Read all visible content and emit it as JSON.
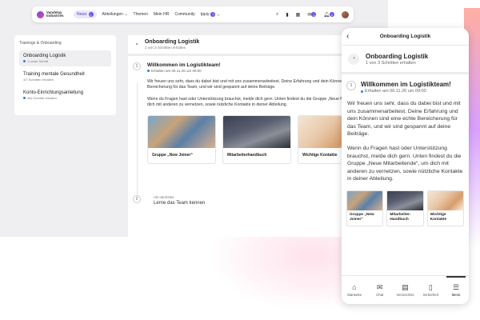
{
  "topbar": {
    "logo_text": "Vandelay Industries",
    "nav": [
      {
        "label": "News",
        "badge": "2"
      },
      {
        "label": "Abteilungen"
      },
      {
        "label": "Themen"
      },
      {
        "label": "Mein HR"
      },
      {
        "label": "Community"
      },
      {
        "label": "Mehr",
        "badge": "1"
      }
    ],
    "notification_badges": {
      "chat": "1",
      "bell": "2"
    }
  },
  "sidebar": {
    "title": "Trainings & Onboarding",
    "items": [
      {
        "label": "Onboarding Logistik",
        "sub": "1 neuer Schritt"
      },
      {
        "label": "Training mentale Gesundheit",
        "sub": "4/7 Schritten erhalten"
      },
      {
        "label": "Konto-Einrichtungsanleitung",
        "sub": "Alle Schritte erhalten"
      }
    ]
  },
  "main": {
    "title": "Onboarding Logistik",
    "subtitle": "1 von 3 Schritten erhalten",
    "post": {
      "number": "1",
      "title": "Willkommen im Logistikteam!",
      "meta": "Erhalten am 06.11.26 um 09:00",
      "para1": "Wir freuen uns sehr, dass du dabei bist und mit uns zusammenarbeitest. Deine Erfahrung und dein Können sind eine echte Bereicherung für das Team, und wir sind gespannt auf deine Beiträge.",
      "para2": "Wenn du Fragen hast oder Unterstützung brauchst, melde dich gern. Unten findest du die Gruppe „Neue Mitarbeitende“, um dich mit anderen zu vernetzen, sowie nützliche Kontakte in deiner Abteilung.",
      "cards": [
        {
          "label": "Gruppe „New Joiner“"
        },
        {
          "label": "Mitarbeiterhandbuch"
        },
        {
          "label": "Wichtige Kontakte"
        }
      ]
    },
    "next": {
      "number": "2",
      "label": "Als nächstes",
      "title": "Lerne das Team kennen"
    }
  },
  "phone": {
    "header_title": "Onboarding Logistik",
    "module_title": "Onboarding Logistik",
    "module_sub": "1 von 3 Schritten erhalten",
    "post_number": "1",
    "post_title": "Willkommen im Logistikteam!",
    "post_meta": "Erhalten am 06.11.26 um 09:00",
    "para1": "Wir freuen uns sehr, dass du dabei bist und mit uns zusammenarbeitest. Deine Erfahrung und dein Können sind eine echte Bereicherung für das Team, und wir sind gespannt auf deine Beiträge.",
    "para2": "Wenn du Fragen hast oder Unterstützung brauchst, melde dich gern. Unten findest du die Gruppe „Neue Mitarbeitende“, um dich mit anderen zu vernetzen, sowie nützliche Kontakte in deiner Abteilung.",
    "cards": [
      {
        "label": "Gruppe „New Joiner“"
      },
      {
        "label": "Mitarbeiter-Handbuch"
      },
      {
        "label": "Wichtige Kontakte"
      }
    ],
    "tabs": [
      {
        "label": "Startseite",
        "icon": "home-icon"
      },
      {
        "label": "Chat",
        "icon": "chat-icon"
      },
      {
        "label": "Verzeichnis",
        "icon": "directory-icon"
      },
      {
        "label": "Sicherheit",
        "icon": "document-icon"
      },
      {
        "label": "Menü",
        "icon": "menu-icon"
      }
    ]
  },
  "colors": {
    "accent": "#6b4de6",
    "status_dot": "#2f7be0"
  }
}
